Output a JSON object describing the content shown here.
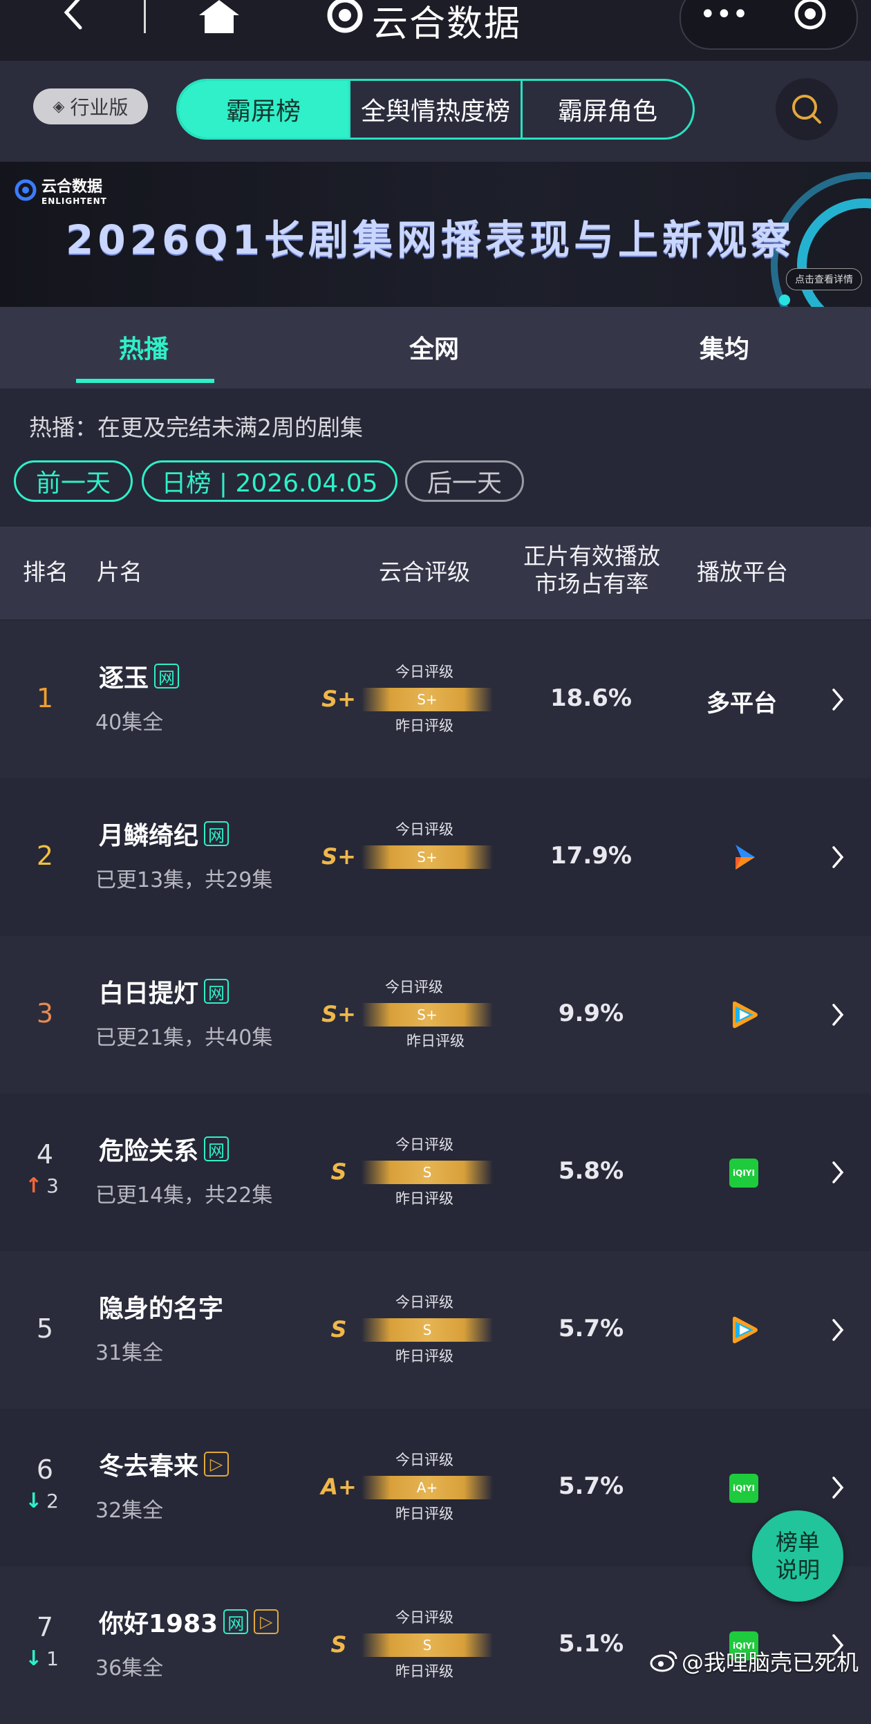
{
  "header": {
    "app_title": "云合数据"
  },
  "toolbar": {
    "industry_label": "行业版",
    "tabs": [
      "霸屏榜",
      "全舆情热度榜",
      "霸屏角色"
    ]
  },
  "banner": {
    "logo_main": "云合数据",
    "logo_sub": "ENLIGHTENT",
    "title": "2026Q1长剧集网播表现与上新观察",
    "detail_button": "点击查看详情"
  },
  "subtabs": [
    "热播",
    "全网",
    "集均"
  ],
  "desc": "热播：在更及完结未满2周的剧集",
  "date_nav": {
    "prev": "前一天",
    "current": "日榜 | 2026.04.05",
    "next": "后一天"
  },
  "table": {
    "headers": {
      "rank": "排名",
      "title": "片名",
      "rating": "云合评级",
      "share_line1": "正片有效播放",
      "share_line2": "市场占有率",
      "platform": "播放平台"
    },
    "today_label": "今日评级",
    "yesterday_label": "昨日评级",
    "rows": [
      {
        "rank": "1",
        "title": "逐玉",
        "tag": "网",
        "tag2": "",
        "eps": "40集全",
        "grade": "S+",
        "bar": "S+",
        "share": "18.6%",
        "platform": "多平台",
        "platform_icon": "",
        "change": ""
      },
      {
        "rank": "2",
        "title": "月鳞绮纪",
        "tag": "网",
        "tag2": "",
        "eps": "已更13集，共29集",
        "grade": "S+",
        "bar": "S+",
        "share": "17.9%",
        "platform": "",
        "platform_icon": "youku-icon",
        "change": ""
      },
      {
        "rank": "3",
        "title": "白日提灯",
        "tag": "网",
        "tag2": "",
        "eps": "已更21集，共40集",
        "grade": "S+",
        "bar": "S+",
        "share": "9.9%",
        "platform": "",
        "platform_icon": "tencent-video-icon",
        "change": ""
      },
      {
        "rank": "4",
        "title": "危险关系",
        "tag": "网",
        "tag2": "",
        "eps": "已更14集，共22集",
        "grade": "S",
        "bar": "S",
        "share": "5.8%",
        "platform": "",
        "platform_icon": "iqiyi-icon",
        "change": "3"
      },
      {
        "rank": "5",
        "title": "隐身的名字",
        "tag": "",
        "tag2": "",
        "eps": "31集全",
        "grade": "S",
        "bar": "S",
        "share": "5.7%",
        "platform": "",
        "platform_icon": "tencent-video-icon",
        "change": ""
      },
      {
        "rank": "6",
        "title": "冬去春来",
        "tag": "",
        "tag2": "▷",
        "eps": "32集全",
        "grade": "A+",
        "bar": "A+",
        "share": "5.7%",
        "platform": "",
        "platform_icon": "iqiyi-icon",
        "change": "2"
      },
      {
        "rank": "7",
        "title": "你好1983",
        "tag": "网",
        "tag2": "▷",
        "eps": "36集全",
        "grade": "S",
        "bar": "S",
        "share": "5.1%",
        "platform": "",
        "platform_icon": "iqiyi-icon",
        "change": "1"
      }
    ]
  },
  "iqiyi_text": "iQIYI",
  "float_button": {
    "line1": "榜单",
    "line2": "说明"
  },
  "watermark": {
    "weibo": "@我哩脑壳已死机"
  },
  "colors": {
    "accent": "#2ff0c8",
    "gold": "#e3a83b",
    "up": "#f2673a",
    "down": "#2ff0c8"
  }
}
